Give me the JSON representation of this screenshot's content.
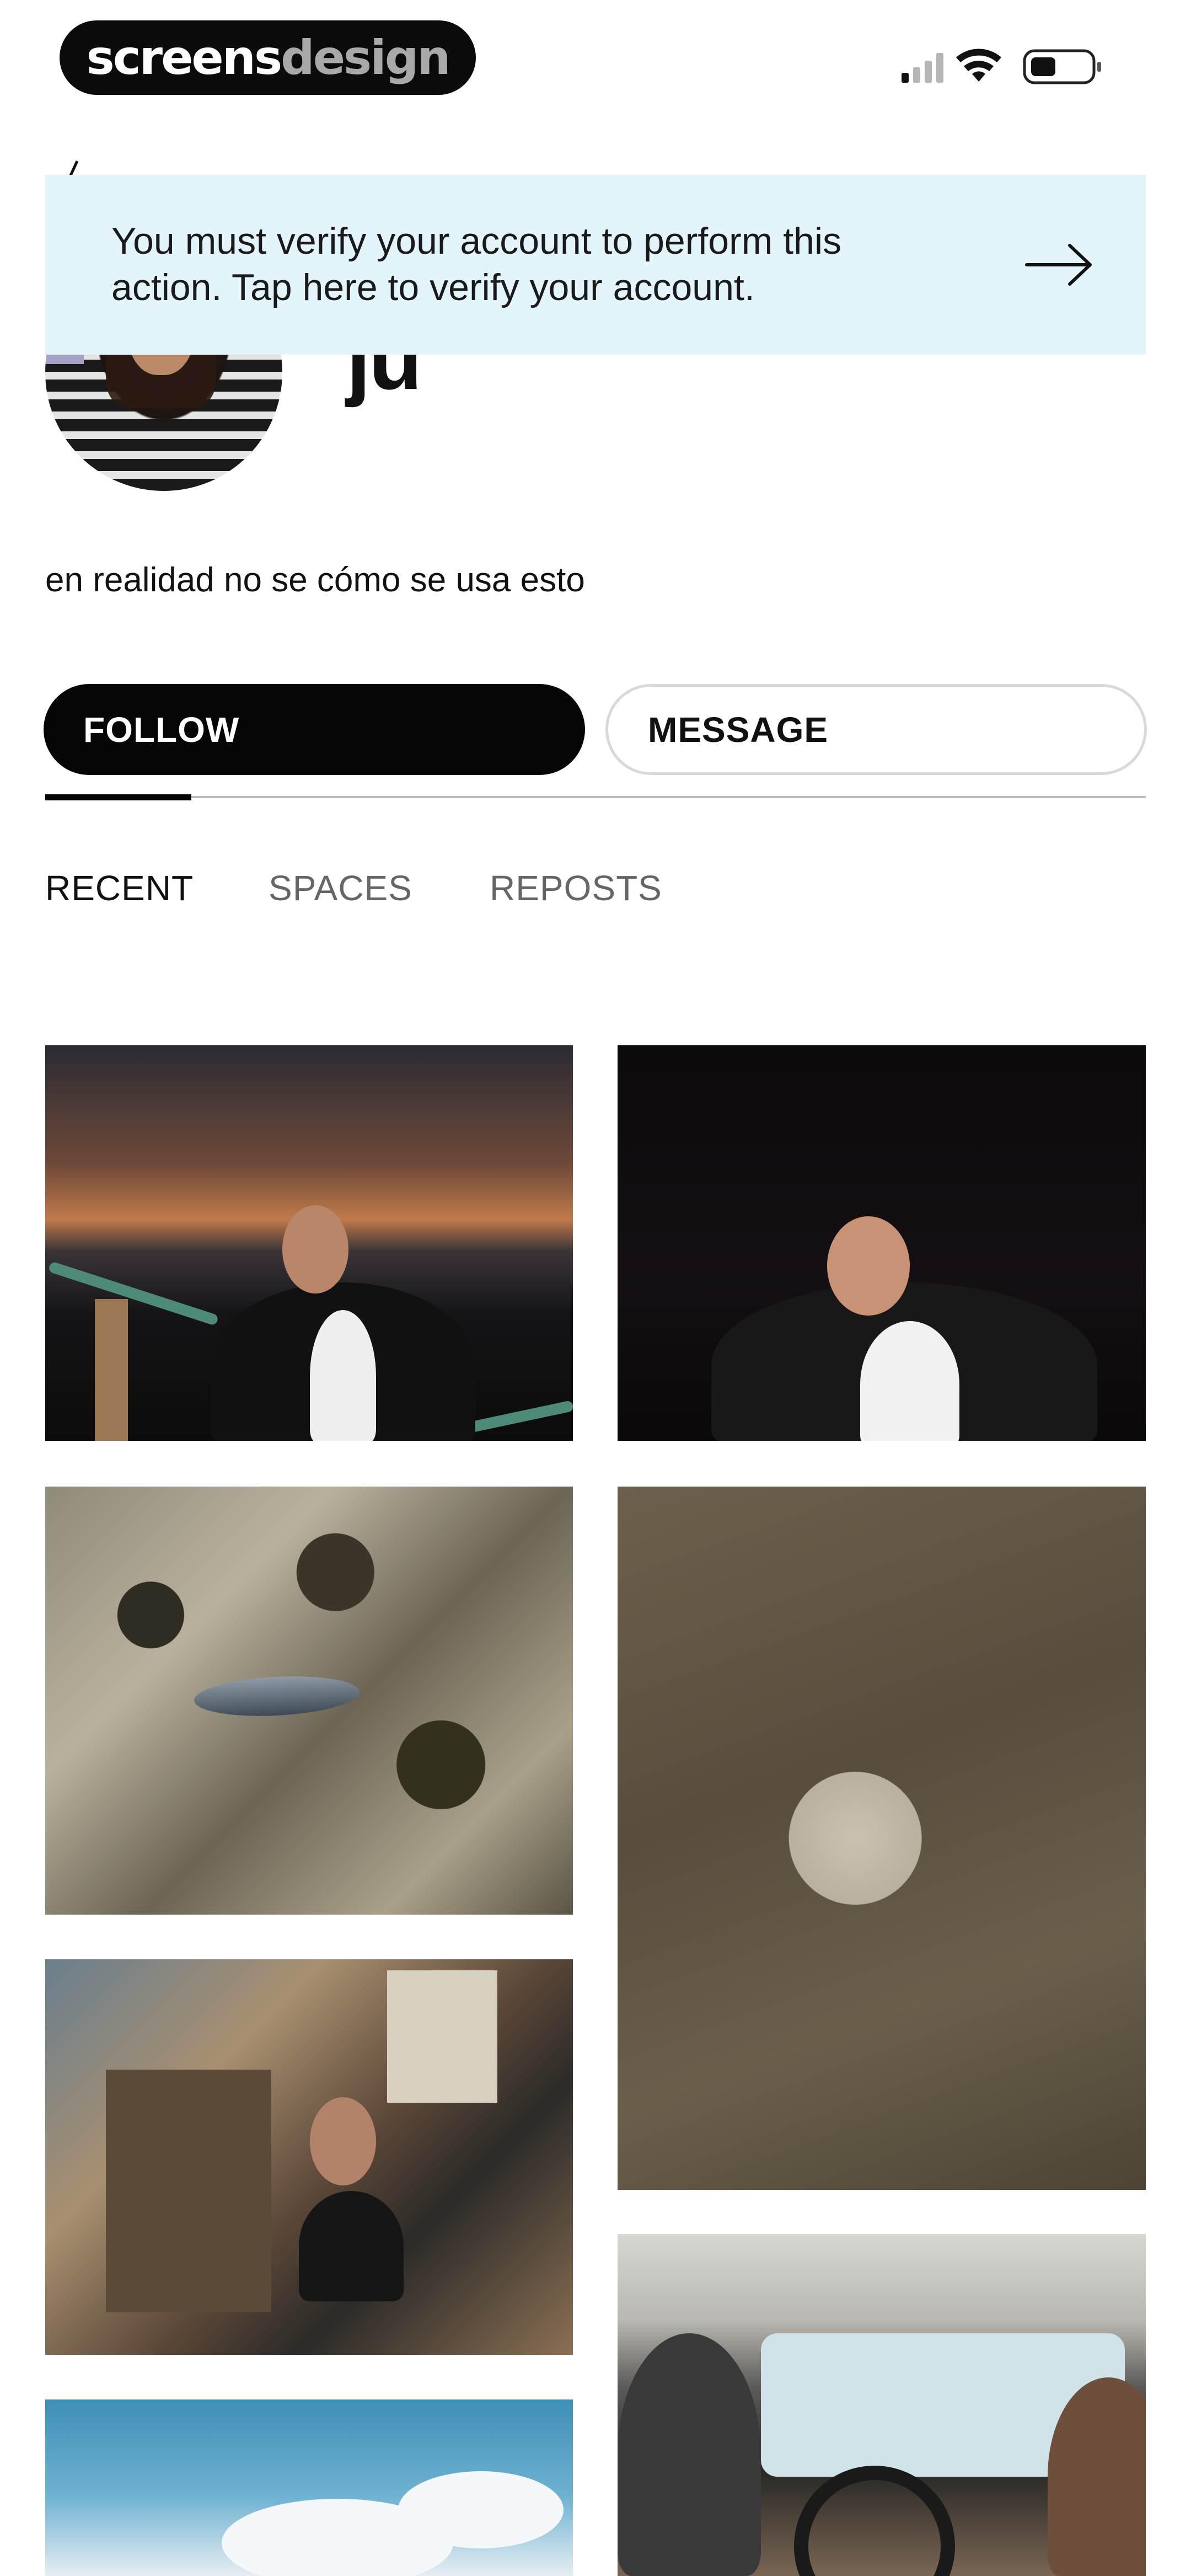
{
  "app": {
    "logo": {
      "part_a": "screens",
      "part_b": "design"
    }
  },
  "status_bar": {
    "icons": [
      "cellular-signal-icon",
      "wifi-icon",
      "battery-icon"
    ]
  },
  "banner": {
    "text": "You must verify your account to perform this action. Tap here to verify your account.",
    "icon": "arrow-right-icon",
    "background": "#e4f4fb"
  },
  "profile": {
    "name": "ju",
    "bio": "en realidad no se cómo se usa esto"
  },
  "actions": {
    "follow_label": "FOLLOW",
    "message_label": "MESSAGE"
  },
  "tabs": [
    {
      "label": "RECENT",
      "active": true
    },
    {
      "label": "SPACES",
      "active": false
    },
    {
      "label": "REPOSTS",
      "active": false
    }
  ],
  "colors": {
    "primary": "#050505",
    "banner_bg": "#e4f4fb",
    "inactive_tab": "#666666"
  }
}
